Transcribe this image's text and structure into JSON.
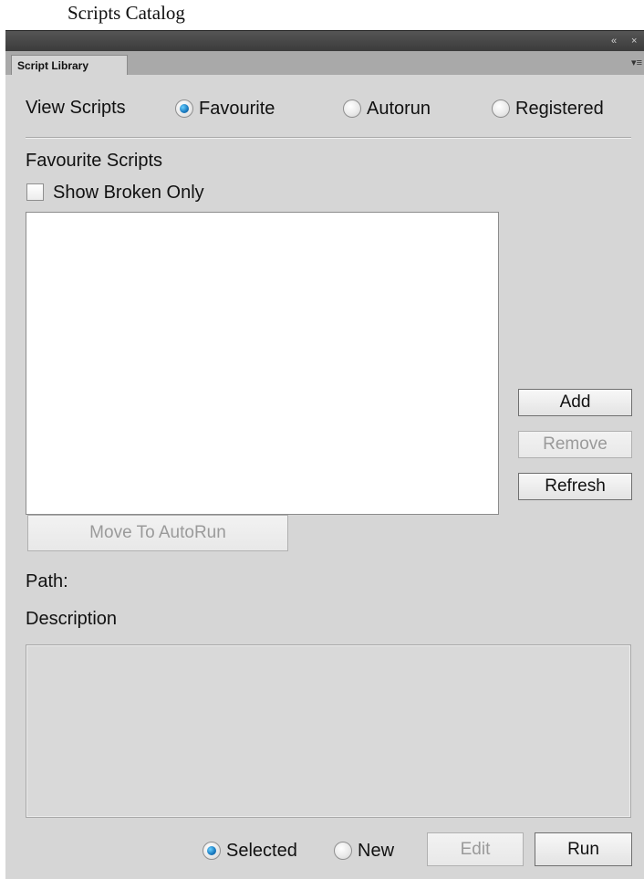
{
  "caption": "Scripts Catalog",
  "window": {
    "collapse_glyph": "«",
    "close_glyph": "×",
    "tab_label": "Script Library",
    "menu_glyph": "▾≡"
  },
  "view_scripts": {
    "label": "View Scripts",
    "options": [
      {
        "label": "Favourite",
        "selected": true
      },
      {
        "label": "Autorun",
        "selected": false
      },
      {
        "label": "Registered",
        "selected": false
      }
    ]
  },
  "favourite": {
    "section_label": "Favourite Scripts",
    "show_broken_label": "Show Broken Only",
    "show_broken_checked": false,
    "items": []
  },
  "buttons": {
    "add": "Add",
    "remove": "Remove",
    "refresh": "Refresh",
    "move_to_autorun": "Move To AutoRun",
    "edit": "Edit",
    "run": "Run"
  },
  "details": {
    "path_label": "Path:",
    "description_label": "Description",
    "description_text": ""
  },
  "run_mode": {
    "options": [
      {
        "label": "Selected",
        "selected": true
      },
      {
        "label": "New",
        "selected": false
      }
    ]
  },
  "colors": {
    "panel_bg": "#d6d6d6",
    "radio_selected": "#1d7fc4"
  }
}
